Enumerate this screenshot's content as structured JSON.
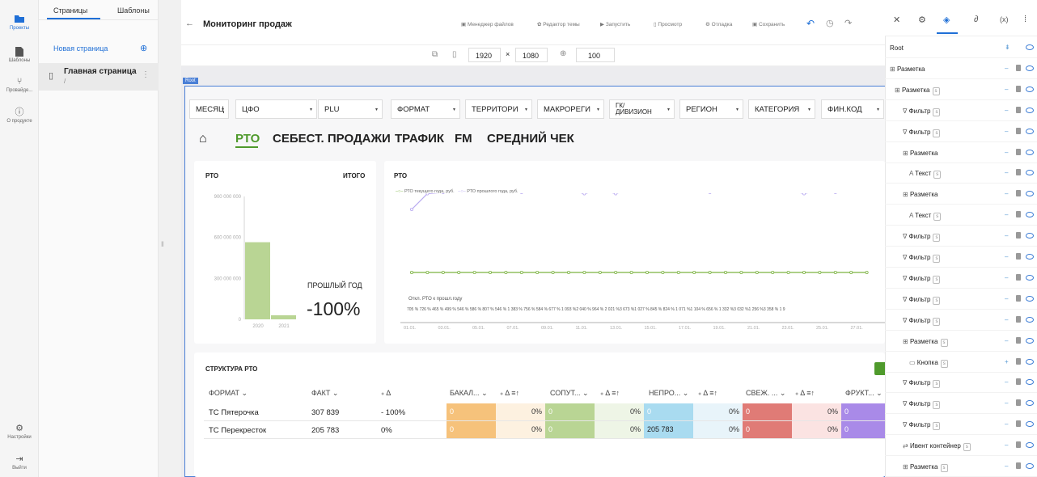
{
  "rail": {
    "items": [
      {
        "label": "Проекты",
        "icon": "folder-icon",
        "active": true
      },
      {
        "label": "Шаблоны",
        "icon": "document-icon"
      },
      {
        "label": "Провайдe...",
        "icon": "provider-icon"
      },
      {
        "label": "О продукте",
        "icon": "info-icon"
      },
      {
        "label": "Настройки",
        "icon": "gear-icon"
      },
      {
        "label": "Выйти",
        "icon": "logout-icon"
      }
    ]
  },
  "pages_panel": {
    "tab_pages": "Страницы",
    "tab_templates": "Шаблоны",
    "new_page": "Новая страница",
    "page_title": "Главная страница",
    "page_path": "/"
  },
  "header": {
    "back_icon": "arrow-left-icon",
    "title": "Мониторинг продаж",
    "buttons": [
      "Менеджер файлов",
      "Редактор темы",
      "Запустить",
      "Просмотр",
      "Отладка",
      "Сохранить"
    ],
    "width": "1920",
    "height": "1080",
    "zoom": "100",
    "size_sep": "×"
  },
  "canvas": {
    "root_label": "Root"
  },
  "filters": [
    "МЕСЯЦ",
    "ЦФО",
    "PLU",
    "ФОРМАТ",
    "ТЕРРИТОРИ",
    "МАКРОРЕГИ",
    "ГК/ ДИВИЗИОН",
    "РЕГИОН",
    "КАТЕГОРИЯ",
    "ФИН.КОД"
  ],
  "tabs": [
    "РТО",
    "СЕБЕСТ. ПРОДАЖИ",
    "ТРАФИК",
    "FM",
    "СРЕДНИЙ ЧЕК"
  ],
  "card_left": {
    "title": "РТО",
    "total": "ИТОГО",
    "prev_label": "ПРОШЛЫЙ ГОД",
    "prev_value": "-100%"
  },
  "card_right": {
    "title": "РТО",
    "dev_label": "Откл. РТО к прошл.году",
    "dev_values": "705 %  726 %  465 %  499 %  546 %  586 %  807 %  546 % 1 383 %  756 %  584 %  677 % 1 093 %2 040 %  964 % 2 021 %3 673 %1 027 %  845 %  824 % 1 071 %1 104 %  656 % 1 332 %3 032 %1 256 %3 358 %     1 9"
  },
  "chart_data": [
    {
      "type": "bar",
      "title": "РТО",
      "categories": [
        "2020",
        "2021"
      ],
      "values": [
        565000000,
        30000000
      ],
      "ylim": [
        0,
        900000000
      ],
      "yticks": [
        "0",
        "300 000 000",
        "600 000 000",
        "900 000 000"
      ],
      "color": "#b9d594"
    },
    {
      "type": "line",
      "title": "РТО",
      "x": [
        "01.01.",
        "03.01.",
        "05.01.",
        "07.01.",
        "09.01.",
        "11.01.",
        "13.01.",
        "15.01.",
        "17.01.",
        "19.01.",
        "21.01.",
        "23.01.",
        "25.01.",
        "27.01.",
        "29"
      ],
      "series": [
        {
          "name": "РТО текущего года, руб.",
          "color": "#7cb342",
          "values": [
            1,
            1,
            1,
            1,
            1,
            1,
            1,
            1,
            1,
            1,
            1,
            1,
            1,
            1,
            1,
            1,
            1,
            1,
            1,
            1,
            1,
            1,
            1,
            1,
            1,
            1,
            1,
            1,
            1,
            1
          ]
        },
        {
          "name": "РТО прошлого года, руб.",
          "color": "#b8a9f0",
          "values": [
            6.2,
            7.5,
            7.6,
            7.8,
            7.8,
            8.4,
            7.8,
            7.6,
            7.8,
            8,
            7.8,
            7.5,
            7.8,
            7.5,
            7.9,
            7.8,
            8,
            8,
            7.8,
            7.6,
            7.8,
            7.8,
            8,
            8.2,
            7.8,
            7.5,
            7.8,
            7.6,
            7.8,
            7.7
          ]
        }
      ]
    }
  ],
  "structure": {
    "title": "СТРУКТУРА РТО",
    "headers": [
      "ФОРМАТ ⌄",
      "ФАКТ ⌄",
      "Δ",
      "БАКАЛ... ⌄",
      "Δ ≡↑",
      "СОПУТ... ⌄",
      "Δ ≡↑",
      "НЕПРО... ⌄",
      "Δ ≡↑",
      "СВЕЖ. ... ⌄",
      "Δ ≡↑",
      "ФРУКТ... ⌄"
    ],
    "rows": [
      {
        "name": "ТС Пятерочка",
        "fact": "307 839",
        "delta": "- 100%",
        "c1": "0",
        "d1": "0%",
        "c2": "0",
        "d2": "0%",
        "c3": "0",
        "d3": "0%",
        "c4": "0",
        "d4": "0%",
        "c5": "0"
      },
      {
        "name": "ТС Перекресток",
        "fact": "205 783",
        "delta": "0%",
        "c1": "0",
        "d1": "0%",
        "c2": "0",
        "d2": "0%",
        "c3": "205 783",
        "d3": "0%",
        "c4": "0",
        "d4": "0%",
        "c5": "0"
      }
    ]
  },
  "right_panel": {
    "icons": [
      "tools-icon",
      "gear-icon",
      "layers-icon",
      "link-icon",
      "variable-icon",
      "grid-icon"
    ],
    "variable_label": "(x)",
    "tree": [
      {
        "label": "Root",
        "indent": 0,
        "icon": "",
        "badge": ""
      },
      {
        "label": "Разметка",
        "indent": 0,
        "icon": "⊞",
        "badge": ""
      },
      {
        "label": "Разметка",
        "indent": 1,
        "icon": "⊞",
        "badge": "s"
      },
      {
        "label": "Фильтр",
        "indent": 2,
        "icon": "∇",
        "badge": "s"
      },
      {
        "label": "Фильтр",
        "indent": 2,
        "icon": "∇",
        "badge": "s"
      },
      {
        "label": "Разметка",
        "indent": 2,
        "icon": "⊞",
        "badge": ""
      },
      {
        "label": "Текст",
        "indent": 3,
        "icon": "A",
        "badge": "s"
      },
      {
        "label": "Разметка",
        "indent": 2,
        "icon": "⊞",
        "badge": ""
      },
      {
        "label": "Текст",
        "indent": 3,
        "icon": "A",
        "badge": "s"
      },
      {
        "label": "Фильтр",
        "indent": 2,
        "icon": "∇",
        "badge": "s"
      },
      {
        "label": "Фильтр",
        "indent": 2,
        "icon": "∇",
        "badge": "s"
      },
      {
        "label": "Фильтр",
        "indent": 2,
        "icon": "∇",
        "badge": "s"
      },
      {
        "label": "Фильтр",
        "indent": 2,
        "icon": "∇",
        "badge": "s"
      },
      {
        "label": "Фильтр",
        "indent": 2,
        "icon": "∇",
        "badge": "s"
      },
      {
        "label": "Разметка",
        "indent": 2,
        "icon": "⊞",
        "badge": "s"
      },
      {
        "label": "Кнопка",
        "indent": 3,
        "icon": "▭",
        "badge": "s"
      },
      {
        "label": "Фильтр",
        "indent": 2,
        "icon": "∇",
        "badge": "s"
      },
      {
        "label": "Фильтр",
        "indent": 2,
        "icon": "∇",
        "badge": "s"
      },
      {
        "label": "Фильтр",
        "indent": 2,
        "icon": "∇",
        "badge": "s"
      },
      {
        "label": "Ивент контейнер",
        "indent": 2,
        "icon": "⇄",
        "badge": "s"
      },
      {
        "label": "Разметка",
        "indent": 2,
        "icon": "⊞",
        "badge": "s"
      }
    ]
  }
}
